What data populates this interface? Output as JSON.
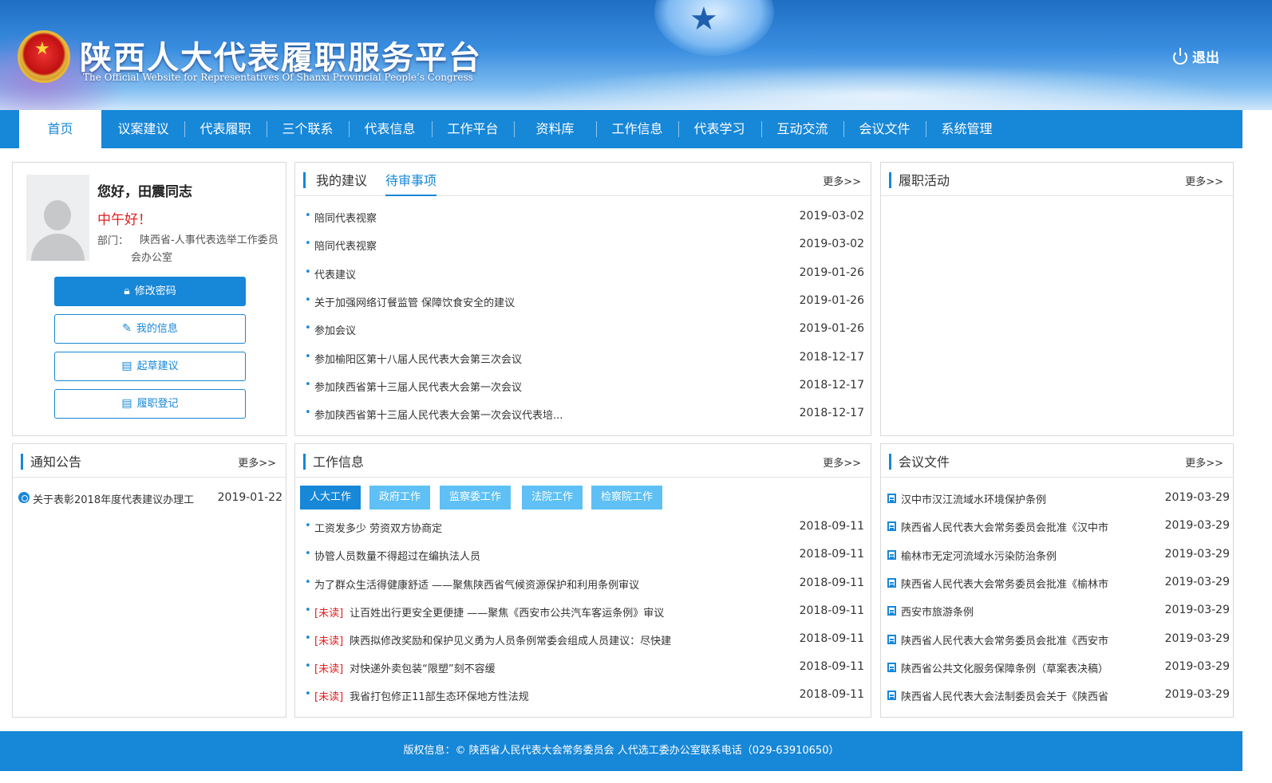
{
  "header": {
    "title": "陕西人大代表履职服务平台",
    "subtitle": "The Official Website for Representatives Of Shanxi Provincial People’s Congress",
    "logout_label": "退出",
    "emblem_icon": "national-emblem-icon",
    "colors": {
      "primary": "#1787d8",
      "header_top": "#1f6fc4"
    }
  },
  "nav": {
    "items": [
      "首页",
      "议案建议",
      "代表履职",
      "三个联系",
      "代表信息",
      "工作平台",
      "资料库",
      "工作信息",
      "代表学习",
      "互动交流",
      "会议文件",
      "系统管理"
    ],
    "active_index": 0
  },
  "profile": {
    "greeting": "您好，田震同志",
    "time_greeting": "中午好！",
    "dept_label": "部门：",
    "dept_value": "陕西省-人事代表选举工作委员会办公室",
    "buttons": [
      "修改密码",
      "我的信息",
      "起草建议",
      "履职登记"
    ]
  },
  "suggestions": {
    "tabs": [
      "我的建议",
      "待审事项"
    ],
    "active_tab": 1,
    "more": "更多>>",
    "items": [
      {
        "title": "陪同代表视察",
        "date": "2019-03-02"
      },
      {
        "title": "陪同代表视察",
        "date": "2019-03-02"
      },
      {
        "title": "代表建议",
        "date": "2019-01-26"
      },
      {
        "title": "关于加强网络订餐监管  保障饮食安全的建议",
        "date": "2019-01-26"
      },
      {
        "title": "参加会议",
        "date": "2019-01-26"
      },
      {
        "title": "参加榆阳区第十八届人民代表大会第三次会议",
        "date": "2018-12-17"
      },
      {
        "title": "参加陕西省第十三届人民代表大会第一次会议",
        "date": "2018-12-17"
      },
      {
        "title": "参加陕西省第十三届人民代表大会第一次会议代表培...",
        "date": "2018-12-17"
      }
    ]
  },
  "activities": {
    "title": "履职活动",
    "more": "更多>>"
  },
  "notices": {
    "title": "通知公告",
    "more": "更多>>",
    "items": [
      {
        "title": "关于表彰2018年度代表建议办理工",
        "date": "2019-01-22"
      }
    ]
  },
  "work_info": {
    "title": "工作信息",
    "more": "更多>>",
    "subtabs": [
      "人大工作",
      "政府工作",
      "监察委工作",
      "法院工作",
      "检察院工作"
    ],
    "active_subtab": 0,
    "unread_label": "[未读]",
    "items": [
      {
        "title": "工资发多少 劳资双方协商定",
        "date": "2018-09-11",
        "unread": false
      },
      {
        "title": "协管人员数量不得超过在编执法人员",
        "date": "2018-09-11",
        "unread": false
      },
      {
        "title": "为了群众生活得健康舒适 ——聚焦陕西省气候资源保护和利用条例审议",
        "date": "2018-09-11",
        "unread": false
      },
      {
        "title": "让百姓出行更安全更便捷 ——聚焦《西安市公共汽车客运条例》审议",
        "date": "2018-09-11",
        "unread": true
      },
      {
        "title": "陕西拟修改奖励和保护见义勇为人员条例常委会组成人员建议：尽快建",
        "date": "2018-09-11",
        "unread": true
      },
      {
        "title": "对快递外卖包装“限塑”刻不容缓",
        "date": "2018-09-11",
        "unread": true
      },
      {
        "title": "我省打包修正11部生态环保地方性法规",
        "date": "2018-09-11",
        "unread": true
      }
    ]
  },
  "meeting_docs": {
    "title": "会议文件",
    "more": "更多>>",
    "items": [
      {
        "title": "汉中市汉江流域水环境保护条例",
        "date": "2019-03-29"
      },
      {
        "title": "陕西省人民代表大会常务委员会批准《汉中市",
        "date": "2019-03-29"
      },
      {
        "title": "榆林市无定河流域水污染防治条例",
        "date": "2019-03-29"
      },
      {
        "title": "陕西省人民代表大会常务委员会批准《榆林市",
        "date": "2019-03-29"
      },
      {
        "title": "西安市旅游条例",
        "date": "2019-03-29"
      },
      {
        "title": "陕西省人民代表大会常务委员会批准《西安市",
        "date": "2019-03-29"
      },
      {
        "title": "陕西省公共文化服务保障条例（草案表决稿）",
        "date": "2019-03-29"
      },
      {
        "title": "陕西省人民代表大会法制委员会关于《陕西省",
        "date": "2019-03-29"
      }
    ]
  },
  "footer": {
    "text": "版权信息：© 陕西省人民代表大会常务委员会 人代选工委办公室联系电话（029-63910650）"
  }
}
